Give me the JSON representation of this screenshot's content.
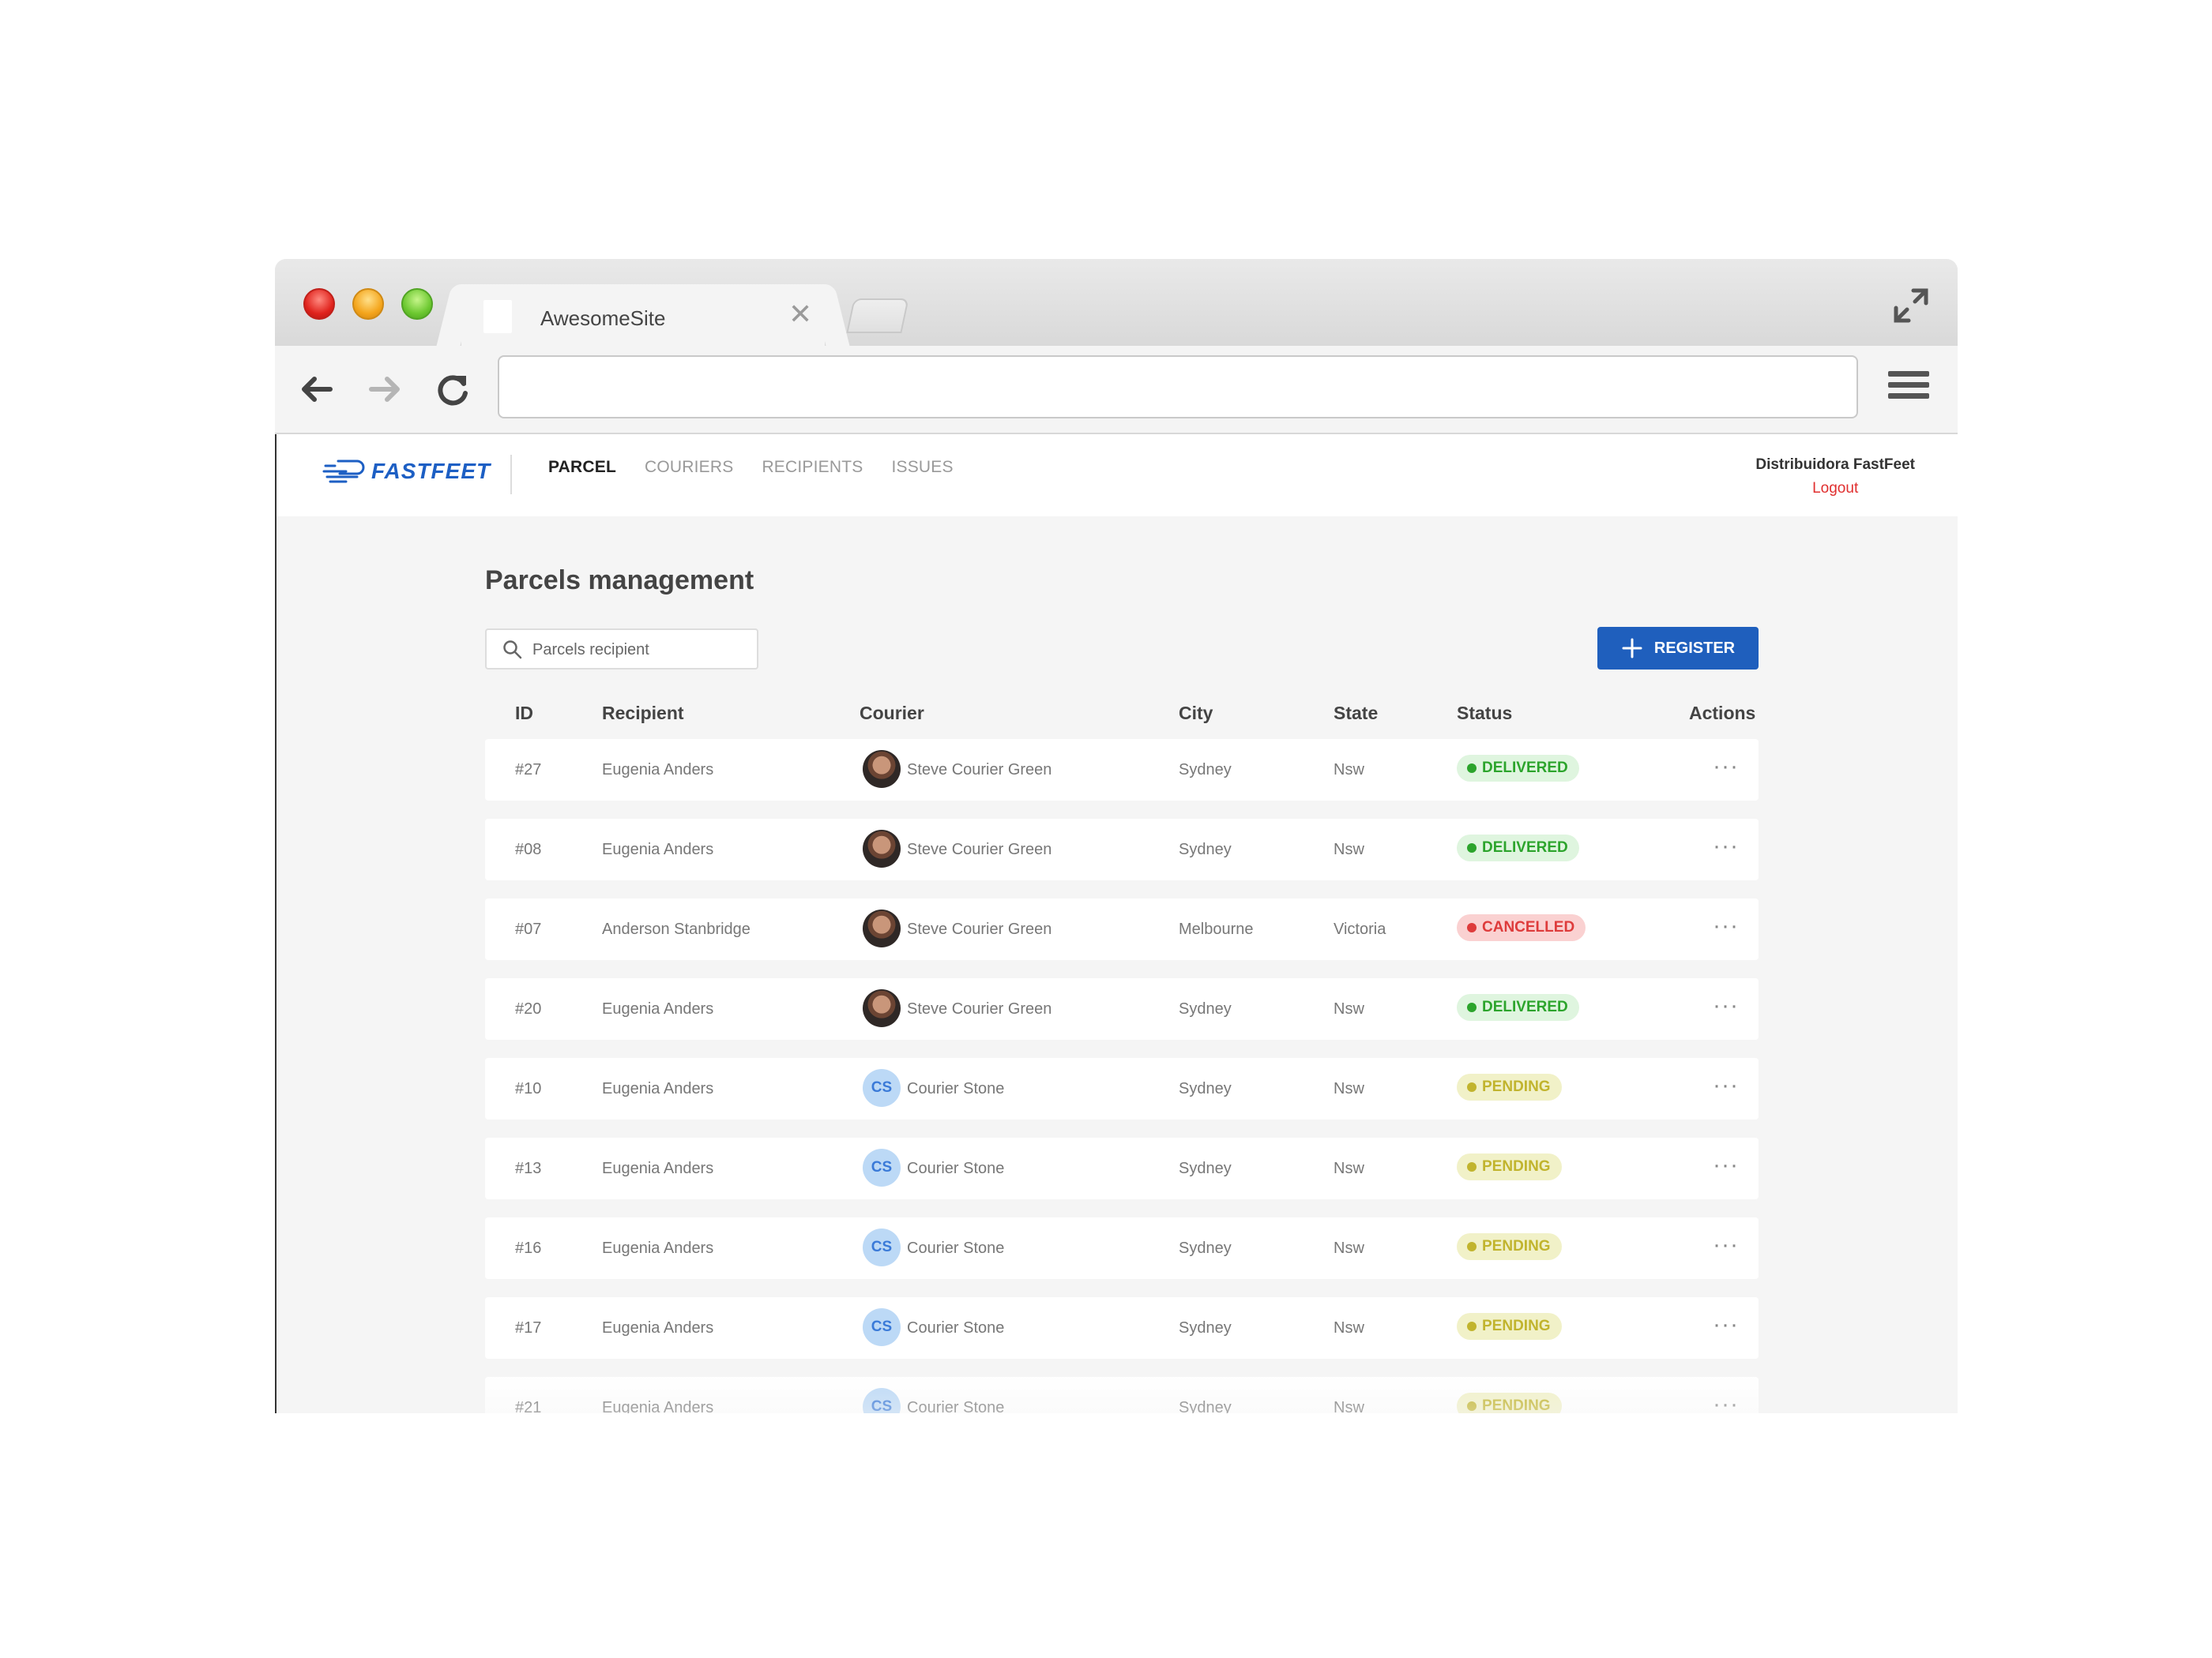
{
  "browser": {
    "tab_title": "AwesomeSite",
    "tab_close": "✕",
    "url": ""
  },
  "app": {
    "logo": "FASTFEET",
    "nav": [
      {
        "label": "PARCEL",
        "active": true
      },
      {
        "label": "COURIERS",
        "active": false
      },
      {
        "label": "RECIPIENTS",
        "active": false
      },
      {
        "label": "ISSUES",
        "active": false
      }
    ],
    "user": {
      "name": "Distribuidora FastFeet",
      "logout_label": "Logout"
    },
    "page_title": "Parcels management",
    "search": {
      "placeholder": "Parcels recipient"
    },
    "register_label": "REGISTER",
    "columns": [
      "ID",
      "Recipient",
      "Courier",
      "City",
      "State",
      "Status",
      "Actions"
    ],
    "rows": [
      {
        "id": "#27",
        "recipient": "Eugenia Anders",
        "courier": "Steve Courier Green",
        "avatar": "photo",
        "initials": "",
        "city": "Sydney",
        "state": "Nsw",
        "status": "DELIVERED",
        "status_kind": "delivered",
        "actions": "···"
      },
      {
        "id": "#08",
        "recipient": "Eugenia Anders",
        "courier": "Steve Courier Green",
        "avatar": "photo",
        "initials": "",
        "city": "Sydney",
        "state": "Nsw",
        "status": "DELIVERED",
        "status_kind": "delivered",
        "actions": "···"
      },
      {
        "id": "#07",
        "recipient": "Anderson Stanbridge",
        "courier": "Steve Courier Green",
        "avatar": "photo",
        "initials": "",
        "city": "Melbourne",
        "state": "Victoria",
        "status": "CANCELLED",
        "status_kind": "cancelled",
        "actions": "···"
      },
      {
        "id": "#20",
        "recipient": "Eugenia Anders",
        "courier": "Steve Courier Green",
        "avatar": "photo",
        "initials": "",
        "city": "Sydney",
        "state": "Nsw",
        "status": "DELIVERED",
        "status_kind": "delivered",
        "actions": "···"
      },
      {
        "id": "#10",
        "recipient": "Eugenia Anders",
        "courier": "Courier Stone",
        "avatar": "initials",
        "initials": "CS",
        "city": "Sydney",
        "state": "Nsw",
        "status": "PENDING",
        "status_kind": "pending",
        "actions": "···"
      },
      {
        "id": "#13",
        "recipient": "Eugenia Anders",
        "courier": "Courier Stone",
        "avatar": "initials",
        "initials": "CS",
        "city": "Sydney",
        "state": "Nsw",
        "status": "PENDING",
        "status_kind": "pending",
        "actions": "···"
      },
      {
        "id": "#16",
        "recipient": "Eugenia Anders",
        "courier": "Courier Stone",
        "avatar": "initials",
        "initials": "CS",
        "city": "Sydney",
        "state": "Nsw",
        "status": "PENDING",
        "status_kind": "pending",
        "actions": "···"
      },
      {
        "id": "#17",
        "recipient": "Eugenia Anders",
        "courier": "Courier Stone",
        "avatar": "initials",
        "initials": "CS",
        "city": "Sydney",
        "state": "Nsw",
        "status": "PENDING",
        "status_kind": "pending",
        "actions": "···"
      },
      {
        "id": "#21",
        "recipient": "Eugenia Anders",
        "courier": "Courier Stone",
        "avatar": "initials",
        "initials": "CS",
        "city": "Sydney",
        "state": "Nsw",
        "status": "PENDING",
        "status_kind": "pending",
        "actions": "···"
      }
    ]
  },
  "colors": {
    "brand": "#1d5fc4",
    "register_button": "#1f5fbd",
    "logout": "#e02e2e",
    "delivered": "#2ca42c",
    "cancelled": "#de3b3b",
    "pending": "#c1b42e"
  },
  "icons": {
    "window_controls": [
      "close-light",
      "minimize-light",
      "zoom-light"
    ],
    "toolbar": [
      "back-arrow-icon",
      "forward-arrow-icon",
      "reload-icon",
      "menu-icon"
    ],
    "search": "search-icon",
    "register": "plus-icon",
    "actions": "more-horizontal-icon"
  }
}
